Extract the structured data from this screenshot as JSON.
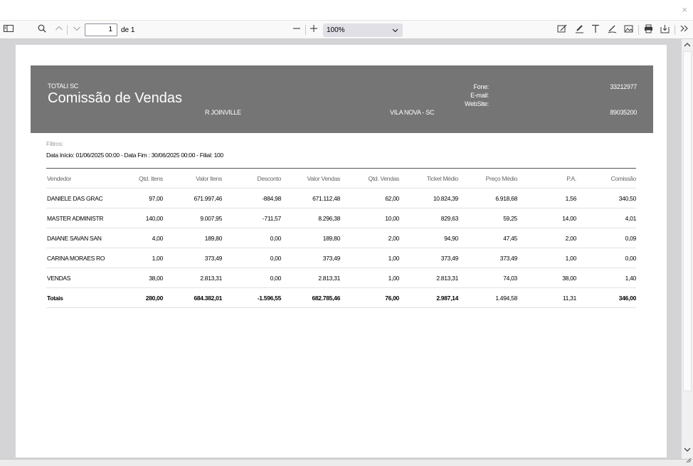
{
  "window": {
    "close_glyph": "×"
  },
  "toolbar": {
    "page_current": "1",
    "page_total_label": "de 1",
    "zoom_value": "100%"
  },
  "report": {
    "company": "TOTALI SC",
    "title": "Comissão de Vendas",
    "address": "R JOINVILLE",
    "city": "VILA NOVA - SC",
    "phone_label": "Fone:",
    "phone_value": "33212977",
    "email_label": "E-mail:",
    "website_label": "WebSite:",
    "cep_value": "89035200",
    "filters_label": "Filtros:",
    "filters_text": "Data Início: 01/06/2025 00:00 - Data Fim : 30/06/2025 00:00 - Filial: 100",
    "columns": [
      "Vendedor",
      "Qtd. Itens",
      "Valor Itens",
      "Desconto",
      "Valor Vendas",
      "Qtd. Vendas",
      "Ticket Médio",
      "Preço Médio",
      "P.A.",
      "Comissão"
    ],
    "rows": [
      [
        "DANIELE DAS GRAC",
        "97,00",
        "671.997,46",
        "-884,98",
        "671.112,48",
        "62,00",
        "10.824,39",
        "6.918,68",
        "1,56",
        "340,50"
      ],
      [
        "MASTER ADMINISTR",
        "140,00",
        "9.007,95",
        "-711,57",
        "8.296,38",
        "10,00",
        "829,63",
        "59,25",
        "14,00",
        "4,01"
      ],
      [
        "DAIANE SAVAN SAN",
        "4,00",
        "189,80",
        "0,00",
        "189,80",
        "2,00",
        "94,90",
        "47,45",
        "2,00",
        "0,09"
      ],
      [
        "CARINA MORAES RO",
        "1,00",
        "373,49",
        "0,00",
        "373,49",
        "1,00",
        "373,49",
        "373,49",
        "1,00",
        "0,00"
      ],
      [
        "VENDAS",
        "38,00",
        "2.813,31",
        "0,00",
        "2.813,31",
        "1,00",
        "2.813,31",
        "74,03",
        "38,00",
        "1,40"
      ]
    ],
    "totals": [
      "Totais",
      "280,00",
      "684.382,01",
      "-1.596,55",
      "682.785,46",
      "76,00",
      "2.987,14",
      "1.494,58",
      "11,31",
      "346,00"
    ]
  },
  "icons": [
    "sidebar-toggle-icon",
    "search-icon",
    "chevron-up-icon",
    "chevron-down-icon",
    "zoom-out-icon",
    "zoom-in-icon",
    "chevron-down-icon",
    "edit-page-icon",
    "highlight-icon",
    "text-icon",
    "draw-icon",
    "image-icon",
    "print-icon",
    "save-icon",
    "more-tools-icon",
    "scroll-up-icon",
    "scroll-down-icon",
    "resize-grip-icon"
  ]
}
